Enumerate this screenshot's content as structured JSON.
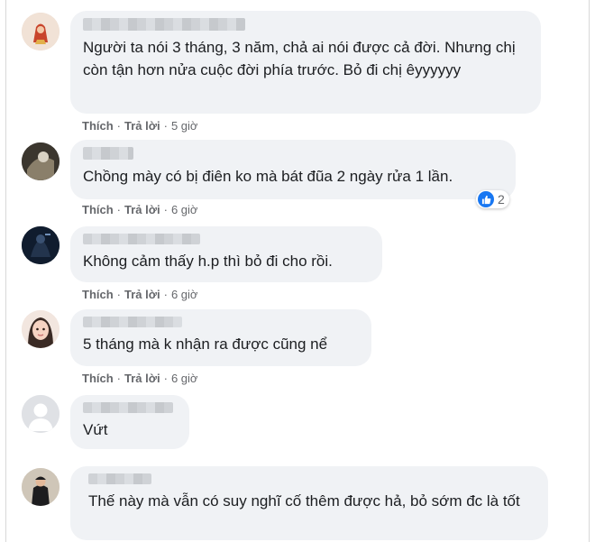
{
  "comments": [
    {
      "text": "Người ta nói 3 tháng, 3 năm, chả ai nói được cả đời. Nhưng chị còn tận hơn nửa cuộc đời phía trước. Bỏ đi chị êyyyyyy",
      "like": "Thích",
      "reply": "Trả lời",
      "time": "5 giờ"
    },
    {
      "text": "Chồng mày có bị điên ko mà bát đũa 2 ngày rửa 1 lần.",
      "like": "Thích",
      "reply": "Trả lời",
      "time": "6 giờ",
      "reaction_count": "2"
    },
    {
      "text": "Không cảm thấy h.p thì bỏ đi cho rồi.",
      "like": "Thích",
      "reply": "Trả lời",
      "time": "6 giờ"
    },
    {
      "text": "5 tháng mà k nhận ra được cũng nể",
      "like": "Thích",
      "reply": "Trả lời",
      "time": "6 giờ"
    },
    {
      "text": "Vứt"
    },
    {
      "text": "Thế này mà vẫn có suy nghĩ cố thêm được hả, bỏ sớm đc là tốt"
    }
  ],
  "colors": {
    "bubble": "#f0f2f5",
    "meta": "#65676b",
    "like_blue": "#1877f2"
  },
  "icons": [
    "avatar-photo",
    "default-avatar-icon",
    "like-reaction-icon"
  ]
}
